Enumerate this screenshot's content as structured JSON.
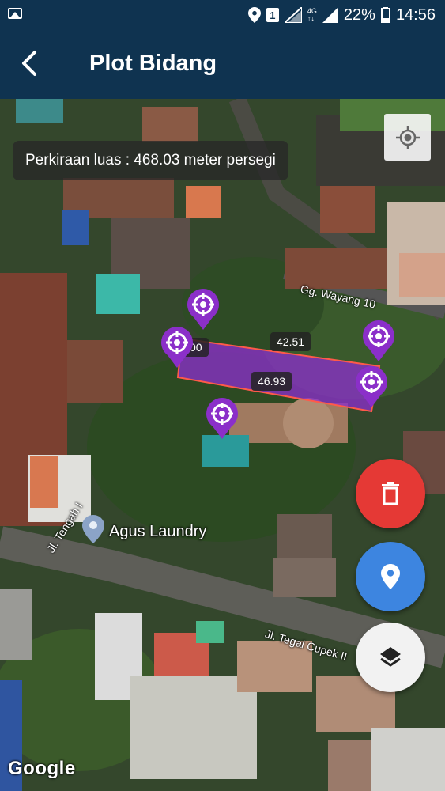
{
  "status_bar": {
    "sim_badge": "1",
    "network": "4G",
    "network_sub": "↑↓",
    "battery": "22%",
    "time": "14:56"
  },
  "app_bar": {
    "title": "Plot Bidang"
  },
  "map": {
    "area_text": "Perkiraan luas : 468.03 meter persegi",
    "edge_labels": {
      "top": "42.51",
      "bottom": "46.93",
      "left_partial": "00"
    },
    "street_labels": [
      "Gg. Wayang 10",
      "Jl. Tengah I",
      "Jl. Tegal Cupek II"
    ],
    "poi_name": "Agus Laundry",
    "attribution": "Google",
    "polygon_fill": "#8b2fc9",
    "polygon_stroke": "#ff5a4a",
    "marker_color": "#8b2fc9"
  },
  "icons": {
    "back": "arrow-left-icon",
    "locate": "my-location-icon",
    "delete": "trash-icon",
    "add_point": "location-pin-icon",
    "layers": "layers-icon"
  },
  "fab_colors": {
    "delete": "#e53935",
    "location": "#3d85e0",
    "layers": "#f2f2f2"
  }
}
